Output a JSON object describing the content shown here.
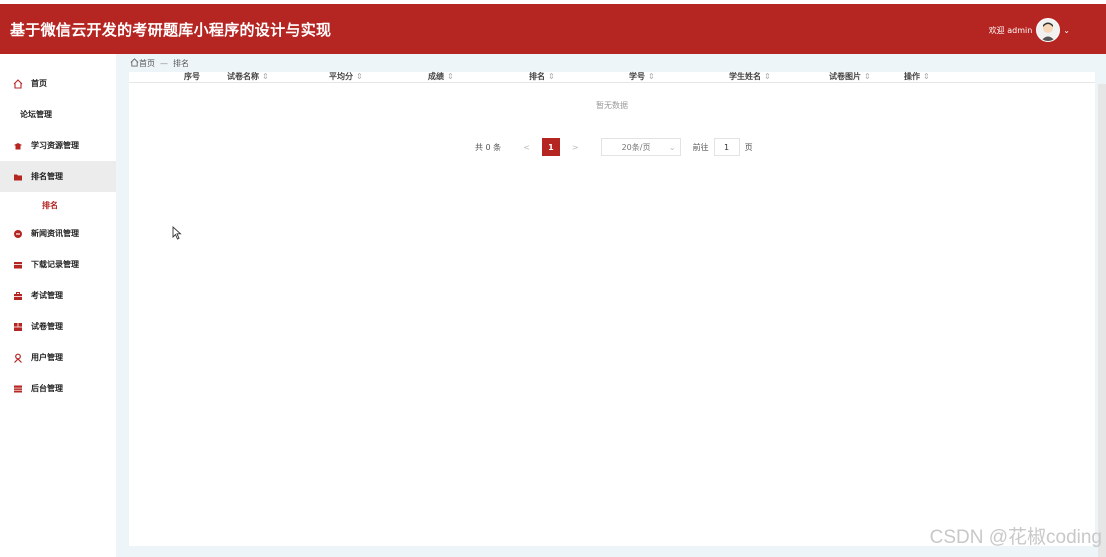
{
  "header": {
    "title": "基于微信云开发的考研题库小程序的设计与实现",
    "welcome": "欢迎 admin",
    "brand_color": "#b52522"
  },
  "sidebar": {
    "items": [
      {
        "label": "首页",
        "icon": "home-icon"
      },
      {
        "label": "论坛管理",
        "icon": ""
      },
      {
        "label": "学习资源管理",
        "icon": "hat-icon"
      },
      {
        "label": "排名管理",
        "icon": "folder-icon",
        "active": true
      },
      {
        "label": "新闻资讯管理",
        "icon": "circle-icon"
      },
      {
        "label": "下载记录管理",
        "icon": "download-icon"
      },
      {
        "label": "考试管理",
        "icon": "briefcase-icon"
      },
      {
        "label": "试卷管理",
        "icon": "grid-icon"
      },
      {
        "label": "用户管理",
        "icon": "user-icon"
      },
      {
        "label": "后台管理",
        "icon": "stack-icon"
      }
    ],
    "submenu": [
      {
        "label": "排名"
      }
    ]
  },
  "breadcrumb": {
    "home": "首页",
    "separator": "—",
    "current": "排名"
  },
  "table": {
    "columns": [
      "序号",
      "试卷名称",
      "平均分",
      "成绩",
      "排名",
      "学号",
      "学生姓名",
      "试卷图片",
      "操作"
    ],
    "sort_glyph": "⇕",
    "empty_text": "暂无数据"
  },
  "pagination": {
    "total": "共 0 条",
    "prev": "<",
    "current": "1",
    "next": ">",
    "page_size": "20条/页",
    "goto": "前往",
    "goto_value": "1",
    "page_unit": "页"
  },
  "watermark": "CSDN @花椒coding"
}
